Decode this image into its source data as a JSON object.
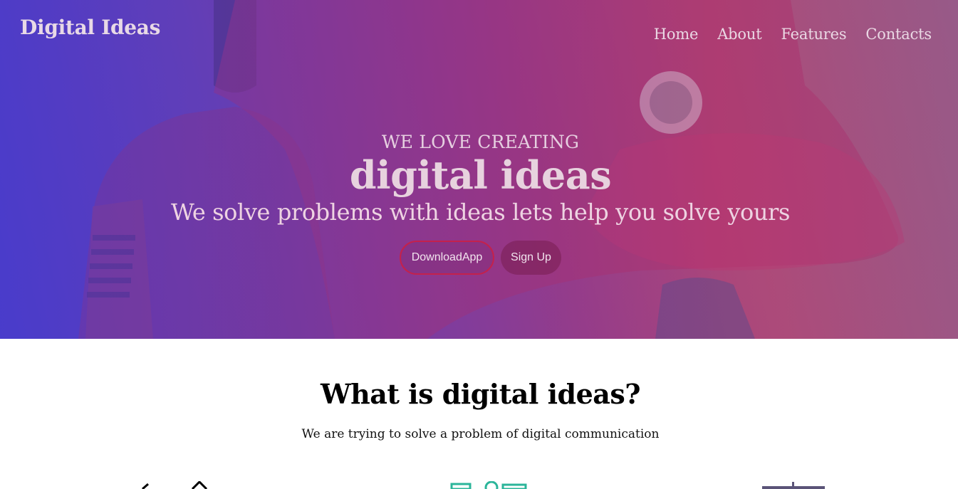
{
  "brand": "Digital Ideas",
  "nav": [
    "Home",
    "About",
    "Features",
    "Contacts"
  ],
  "hero": {
    "eyebrow": "WE LOVE CREATING",
    "headline": "digital ideas",
    "tagline": "We solve problems with ideas lets help you solve yours",
    "download_label": "DownloadApp",
    "signup_label": "Sign Up"
  },
  "about": {
    "title": "What is digital ideas?",
    "subtitle": "We are trying to solve a problem of digital communication"
  },
  "icons": [
    "rocket-icon",
    "mobile-chart-icon",
    "presentation-icon"
  ],
  "colors": {
    "accent_border": "#c4214c",
    "hero_purple": "#4a3bc9",
    "hero_red": "#b24a78"
  }
}
